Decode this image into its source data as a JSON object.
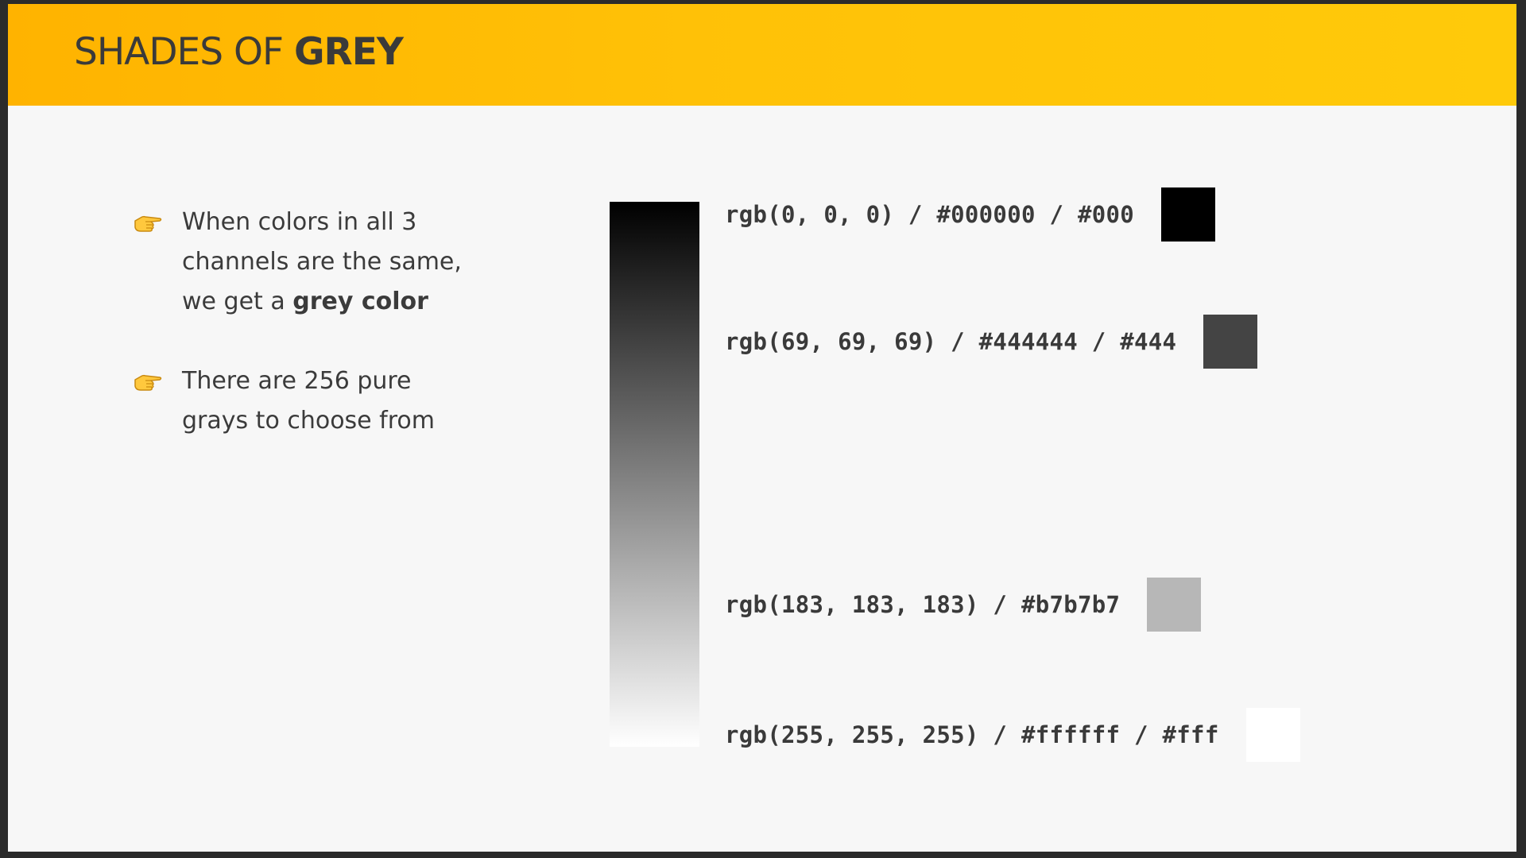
{
  "slide": {
    "title_prefix": "SHADES OF ",
    "title_strong": "GREY",
    "header_color": "#ffb300"
  },
  "bullets": [
    {
      "icon": "pointing-hand-icon",
      "line1": "When colors in all 3",
      "line2": "channels are the same,",
      "line3_prefix": "we get a ",
      "line3_strong": "grey color"
    },
    {
      "icon": "pointing-hand-icon",
      "line1": "There are 256 pure",
      "line2": "grays to choose from"
    }
  ],
  "gradient": {
    "from": "#000000",
    "to": "#ffffff"
  },
  "swatches": [
    {
      "label": "rgb(0, 0, 0) / #000000 / #000",
      "color": "#000000"
    },
    {
      "label": "rgb(69, 69, 69) / #444444 / #444",
      "color": "#444444"
    },
    {
      "label": "rgb(183, 183, 183) / #b7b7b7",
      "color": "#b7b7b7"
    },
    {
      "label": "rgb(255, 255, 255) / #ffffff / #fff",
      "color": "#ffffff"
    }
  ]
}
